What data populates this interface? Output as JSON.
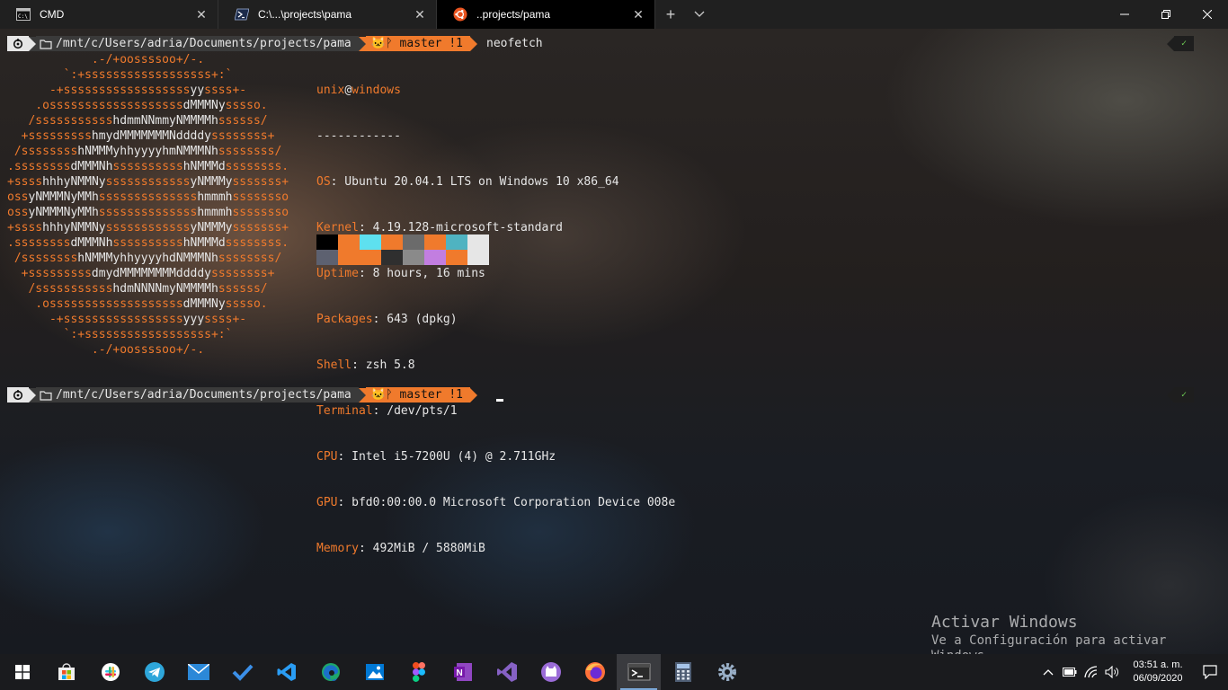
{
  "tabs": [
    {
      "label": "CMD",
      "icon": "cmd-icon",
      "active": false
    },
    {
      "label": "C:\\...\\projects\\pama",
      "icon": "powershell-icon",
      "active": false
    },
    {
      "label": "..projects/pama",
      "icon": "ubuntu-icon",
      "active": true
    }
  ],
  "new_tab": "+",
  "tab_menu": "⌵",
  "window_controls": {
    "minimize": "—",
    "maximize": "❐",
    "close": "✕"
  },
  "prompt": {
    "os_icon": "⎈",
    "path": "/mnt/c/Users/adria/Documents/projects/pama",
    "git": "🐱ᚹ master !1",
    "command1": "neofetch",
    "command2": "",
    "status": "✓"
  },
  "neofetch": {
    "user": "unix",
    "at": "@",
    "host": "windows",
    "divider": "------------",
    "fields": [
      {
        "key": "OS",
        "value": ": Ubuntu 20.04.1 LTS on Windows 10 x86_64"
      },
      {
        "key": "Kernel",
        "value": ": 4.19.128-microsoft-standard"
      },
      {
        "key": "Uptime",
        "value": ": 8 hours, 16 mins"
      },
      {
        "key": "Packages",
        "value": ": 643 (dpkg)"
      },
      {
        "key": "Shell",
        "value": ": zsh 5.8"
      },
      {
        "key": "Terminal",
        "value": ": /dev/pts/1"
      },
      {
        "key": "CPU",
        "value": ": Intel i5-7200U (4) @ 2.711GHz"
      },
      {
        "key": "GPU",
        "value": ": bfd0:00:00.0 Microsoft Corporation Device 008e"
      },
      {
        "key": "Memory",
        "value": ": 492MiB / 5880MiB"
      }
    ],
    "palette_top": [
      "#000000",
      "#f07a2c",
      "#5ee0ef",
      "#f07a2c",
      "#6b6b6b",
      "#f07a2c",
      "#4fb3c1",
      "#e6e6e6"
    ],
    "palette_bottom": [
      "#5d6170",
      "#f07a2c",
      "#f07a2c",
      "#2f2f2f",
      "#8a8a8a",
      "#c27ee0",
      "#f07a2c",
      "#e6e6e6"
    ]
  },
  "ascii_art": [
    "            .-/+oossssoo+/-.",
    "        `:+ssssssssssssssssss+:`",
    "      -+ssssssssssssssssssyyssss+-",
    "    .osssssssssssssssssssdMMMNysssso.",
    "   /ssssssssssshdmmNNmmyNMMMMhssssss/",
    "  +ssssssssshmydMMMMMMMNddddyssssssss+",
    " /sssssssshNMMMyhhyyyyhmNMMMNhssssssss/",
    ".ssssssssdMMMNhsssssssssshNMMMdssssssss.",
    "+sssshhhyNMMNyssssssssssssyNMMMysssssss+",
    "ossyNMMMNyMMhsssssssssssssshmmmhssssssso",
    "ossyNMMMNyMMhsssssssssssssshmmmhssssssso",
    "+sssshhhyNMMNyssssssssssssyNMMMysssssss+",
    ".ssssssssdMMMNhsssssssssshNMMMdssssssss.",
    " /sssssssshNMMMyhhyyyyhdNMMMNhssssssss/",
    "  +sssssssssdmydMMMMMMMMddddyssssssss+",
    "   /ssssssssssshdmNNNNmyNMMMMhssssss/",
    "    .osssssssssssssssssssdMMMNysssso.",
    "      -+sssssssssssssssssyyyssss+-",
    "        `:+ssssssssssssssssss+:`",
    "            .-/+oossssoo+/-."
  ],
  "activate": {
    "title": "Activar Windows",
    "subtitle": "Ve a Configuración para activar Windows."
  },
  "taskbar": {
    "apps": [
      "windows-start-icon",
      "store-icon",
      "slack-icon",
      "telegram-icon",
      "mail-icon",
      "todo-icon",
      "vscode-icon",
      "edge-icon",
      "photos-icon",
      "figma-icon",
      "onenote-icon",
      "visual-studio-icon",
      "github-desktop-icon",
      "firefox-icon",
      "windows-terminal-icon",
      "calculator-icon",
      "settings-icon"
    ],
    "tray_icons": [
      "chevron-up-icon",
      "battery-icon",
      "wifi-icon",
      "volume-icon"
    ],
    "time": "03:51 a. m.",
    "date": "06/09/2020"
  }
}
